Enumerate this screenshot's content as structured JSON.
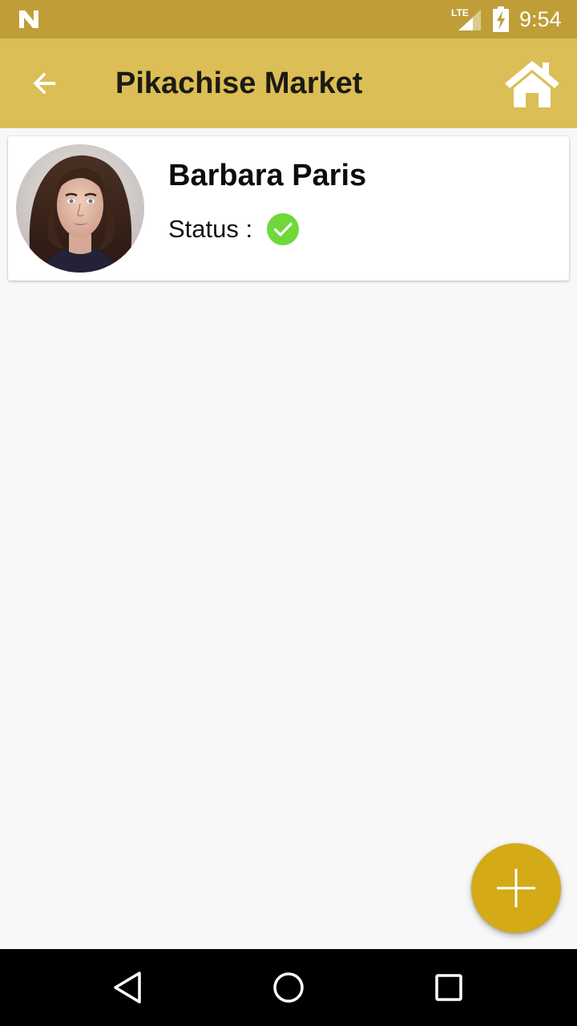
{
  "status_bar": {
    "network": "LTE",
    "time": "9:54",
    "icons": [
      "notification-n-icon",
      "lte-signal-icon",
      "battery-charging-icon"
    ]
  },
  "app_bar": {
    "title": "Pikachise Market",
    "back_icon": "arrow-back-icon",
    "home_icon": "home-icon"
  },
  "customers": [
    {
      "name": "Barbara Paris",
      "status_label": "Status :",
      "status_icon": "check-circle-icon",
      "status_color": "#6fd83a"
    }
  ],
  "fab": {
    "icon": "plus-icon"
  },
  "nav_bar": {
    "icons": [
      "back-triangle-icon",
      "home-circle-icon",
      "recents-square-icon"
    ]
  },
  "colors": {
    "status_bar": "#bf9e38",
    "app_bar": "#dbbe55",
    "fab": "#d4aa17",
    "background": "#f8f8f8",
    "status_ok": "#6fd83a"
  }
}
